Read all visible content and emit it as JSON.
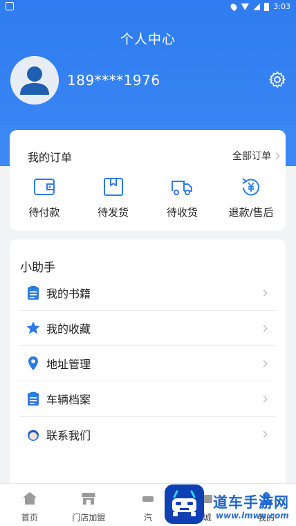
{
  "status_bar": {
    "time": "3:03"
  },
  "header": {
    "title": "个人中心",
    "phone": "189****1976"
  },
  "orders": {
    "title": "我的订单",
    "all_label": "全部订单",
    "items": [
      {
        "label": "待付款",
        "icon": "wallet-icon"
      },
      {
        "label": "待发货",
        "icon": "package-icon"
      },
      {
        "label": "待收货",
        "icon": "truck-icon"
      },
      {
        "label": "退款/售后",
        "icon": "refund-icon"
      }
    ]
  },
  "helper": {
    "title": "小助手",
    "items": [
      {
        "label": "我的书籍",
        "icon": "clipboard-icon"
      },
      {
        "label": "我的收藏",
        "icon": "star-icon"
      },
      {
        "label": "地址管理",
        "icon": "location-pin-icon"
      },
      {
        "label": "车辆档案",
        "icon": "clipboard-icon"
      },
      {
        "label": "联系我们",
        "icon": "customer-service-icon"
      }
    ]
  },
  "tab_bar": {
    "items": [
      {
        "label": "首页"
      },
      {
        "label": "门店加盟"
      },
      {
        "label": "汽"
      },
      {
        "label": "城"
      },
      {
        "label": "我的"
      }
    ]
  },
  "watermark": {
    "brand": "道车手游网",
    "url": "www.lmwu.com"
  },
  "colors": {
    "primary": "#2f7cf0",
    "icon_blue": "#2d7be5"
  }
}
